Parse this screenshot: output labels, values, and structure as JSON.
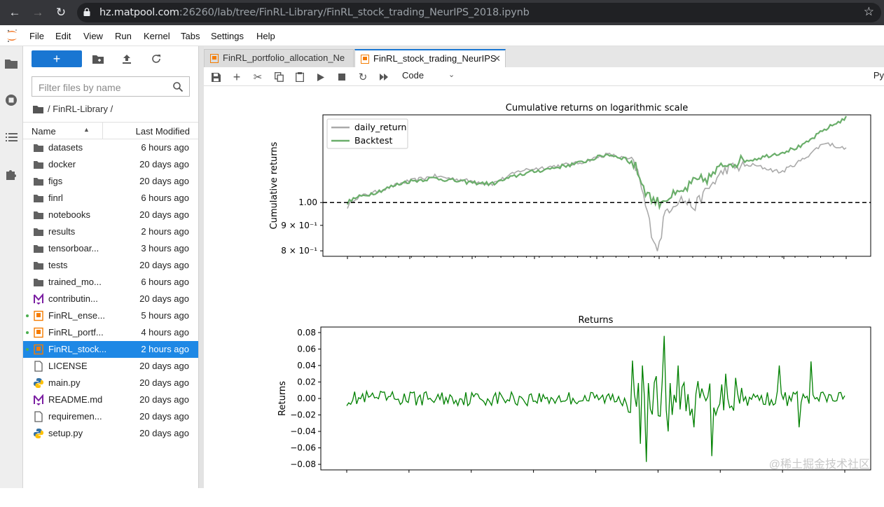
{
  "browser": {
    "url_host": "hz.matpool.com",
    "url_rest": ":26260/lab/tree/FinRL-Library/FinRL_stock_trading_NeurIPS_2018.ipynb"
  },
  "menu": [
    "File",
    "Edit",
    "View",
    "Run",
    "Kernel",
    "Tabs",
    "Settings",
    "Help"
  ],
  "filebrowser": {
    "new_label": "+",
    "filter_placeholder": "Filter files by name",
    "breadcrumb": "/ FinRL-Library /",
    "col_name": "Name",
    "col_modified": "Last Modified",
    "items": [
      {
        "name": "datasets",
        "modified": "6 hours ago",
        "icon": "folder-icon",
        "running": false,
        "selected": false
      },
      {
        "name": "docker",
        "modified": "20 days ago",
        "icon": "folder-icon",
        "running": false,
        "selected": false
      },
      {
        "name": "figs",
        "modified": "20 days ago",
        "icon": "folder-icon",
        "running": false,
        "selected": false
      },
      {
        "name": "finrl",
        "modified": "6 hours ago",
        "icon": "folder-icon",
        "running": false,
        "selected": false
      },
      {
        "name": "notebooks",
        "modified": "20 days ago",
        "icon": "folder-icon",
        "running": false,
        "selected": false
      },
      {
        "name": "results",
        "modified": "2 hours ago",
        "icon": "folder-icon",
        "running": false,
        "selected": false
      },
      {
        "name": "tensorboar...",
        "modified": "3 hours ago",
        "icon": "folder-icon",
        "running": false,
        "selected": false
      },
      {
        "name": "tests",
        "modified": "20 days ago",
        "icon": "folder-icon",
        "running": false,
        "selected": false
      },
      {
        "name": "trained_mo...",
        "modified": "6 hours ago",
        "icon": "folder-icon",
        "running": false,
        "selected": false
      },
      {
        "name": "contributin...",
        "modified": "20 days ago",
        "icon": "markdown-icon",
        "running": false,
        "selected": false
      },
      {
        "name": "FinRL_ense...",
        "modified": "5 hours ago",
        "icon": "notebook-icon",
        "running": true,
        "selected": false
      },
      {
        "name": "FinRL_portf...",
        "modified": "4 hours ago",
        "icon": "notebook-icon",
        "running": true,
        "selected": false
      },
      {
        "name": "FinRL_stock...",
        "modified": "2 hours ago",
        "icon": "notebook-icon",
        "running": true,
        "selected": true
      },
      {
        "name": "LICENSE",
        "modified": "20 days ago",
        "icon": "file-icon",
        "running": false,
        "selected": false
      },
      {
        "name": "main.py",
        "modified": "20 days ago",
        "icon": "python-icon",
        "running": false,
        "selected": false
      },
      {
        "name": "README.md",
        "modified": "20 days ago",
        "icon": "markdown-icon",
        "running": false,
        "selected": false
      },
      {
        "name": "requiremen...",
        "modified": "20 days ago",
        "icon": "file-icon",
        "running": false,
        "selected": false
      },
      {
        "name": "setup.py",
        "modified": "20 days ago",
        "icon": "python-icon",
        "running": false,
        "selected": false
      }
    ]
  },
  "tabs": [
    {
      "label": "FinRL_portfolio_allocation_Ne",
      "active": false
    },
    {
      "label": "FinRL_stock_trading_NeurIPS",
      "active": true
    }
  ],
  "notebook_toolbar": {
    "cell_type": "Code",
    "kernel": "Py"
  },
  "colors": {
    "accent": "#1976d2",
    "daily_return": "#aaaaaa",
    "backtest": "#6aae6a",
    "returns": "#008000"
  },
  "watermark": "@稀土掘金技术社区",
  "chart_data": [
    {
      "type": "line",
      "title": "Cumulative returns on logarithmic scale",
      "ylabel": "Cumulative returns",
      "xlabel": "",
      "yscale": "log",
      "ylim": [
        0.78,
        1.5
      ],
      "ytick_labels": [
        "1.00",
        "9 × 10⁻¹",
        "8 × 10⁻¹"
      ],
      "ytick_values": [
        1.0,
        0.9,
        0.8
      ],
      "hline": 1.0,
      "legend": "top-left",
      "n_points": 252,
      "series": [
        {
          "name": "daily_return",
          "color": "#aaaaaa",
          "key": [
            [
              0,
              0.98
            ],
            [
              5,
              1.02
            ],
            [
              20,
              1.05
            ],
            [
              40,
              1.1
            ],
            [
              60,
              1.13
            ],
            [
              80,
              1.11
            ],
            [
              100,
              1.09
            ],
            [
              120,
              1.16
            ],
            [
              140,
              1.18
            ],
            [
              160,
              1.2
            ],
            [
              180,
              1.25
            ],
            [
              195,
              1.22
            ],
            [
              200,
              1.17
            ],
            [
              205,
              1.02
            ],
            [
              210,
              0.88
            ],
            [
              215,
              0.8
            ],
            [
              220,
              0.96
            ],
            [
              230,
              1.02
            ],
            [
              240,
              0.98
            ],
            [
              250,
              1.07
            ],
            [
              262,
              1.17
            ],
            [
              280,
              1.19
            ],
            [
              300,
              1.15
            ],
            [
              315,
              1.22
            ],
            [
              330,
              1.32
            ],
            [
              345,
              1.28
            ]
          ]
        },
        {
          "name": "Backtest",
          "color": "#6aae6a",
          "key": [
            [
              0,
              1.0
            ],
            [
              5,
              1.02
            ],
            [
              20,
              1.05
            ],
            [
              40,
              1.1
            ],
            [
              60,
              1.12
            ],
            [
              80,
              1.1
            ],
            [
              100,
              1.09
            ],
            [
              120,
              1.14
            ],
            [
              140,
              1.17
            ],
            [
              160,
              1.2
            ],
            [
              180,
              1.25
            ],
            [
              195,
              1.22
            ],
            [
              200,
              1.17
            ],
            [
              205,
              1.07
            ],
            [
              210,
              1.02
            ],
            [
              215,
              1.0
            ],
            [
              220,
              1.02
            ],
            [
              230,
              1.04
            ],
            [
              240,
              1.1
            ],
            [
              250,
              1.12
            ],
            [
              262,
              1.2
            ],
            [
              280,
              1.22
            ],
            [
              300,
              1.26
            ],
            [
              315,
              1.3
            ],
            [
              330,
              1.4
            ],
            [
              345,
              1.48
            ]
          ]
        }
      ]
    },
    {
      "type": "line",
      "title": "Returns",
      "ylabel": "Returns",
      "xlabel": "",
      "ylim": [
        -0.085,
        0.085
      ],
      "yticks": [
        0.08,
        0.06,
        0.04,
        0.02,
        0.0,
        -0.02,
        -0.04,
        -0.06,
        -0.08
      ],
      "ytick_labels": [
        "0.08",
        "0.06",
        "0.04",
        "0.02",
        "0.00",
        "−0.02",
        "−0.04",
        "−0.06",
        "−0.08"
      ],
      "series": [
        {
          "name": "",
          "color": "#008000",
          "spikes": [
            [
              198,
              0.046
            ],
            [
              200,
              -0.01
            ],
            [
              204,
              -0.055
            ],
            [
              205,
              0.04
            ],
            [
              208,
              -0.077
            ],
            [
              215,
              0.027
            ],
            [
              220,
              0.076
            ],
            [
              223,
              -0.04
            ],
            [
              230,
              0.04
            ],
            [
              240,
              -0.035
            ],
            [
              253,
              -0.07
            ],
            [
              262,
              0.03
            ],
            [
              270,
              0.025
            ],
            [
              300,
              0.04
            ],
            [
              314,
              -0.035
            ],
            [
              322,
              0.045
            ]
          ]
        }
      ]
    }
  ]
}
